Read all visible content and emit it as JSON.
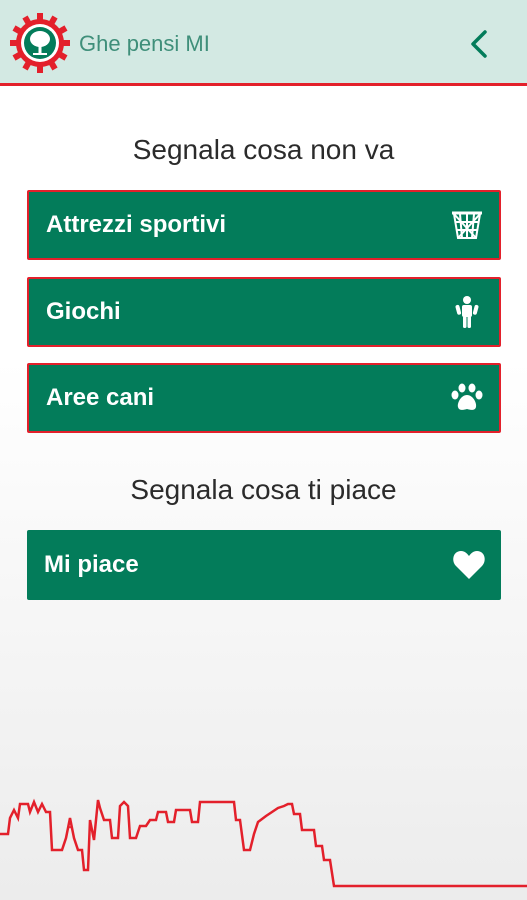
{
  "app": {
    "title": "Ghe pensi MI"
  },
  "icons": {
    "logo": "tree-logo-icon",
    "back": "chevron-left-icon"
  },
  "colors": {
    "accent_green": "#037c5a",
    "accent_red": "#e3202b",
    "header_bg": "#d3e9e3",
    "title_text": "#3f8f7a"
  },
  "report_problem": {
    "heading": "Segnala cosa non va",
    "items": [
      {
        "label": "Attrezzi sportivi",
        "icon": "basketball-hoop-icon"
      },
      {
        "label": "Giochi",
        "icon": "child-icon"
      },
      {
        "label": "Aree cani",
        "icon": "paw-icon"
      }
    ]
  },
  "report_like": {
    "heading": "Segnala cosa ti piace",
    "items": [
      {
        "label": "Mi piace",
        "icon": "heart-icon"
      }
    ]
  }
}
